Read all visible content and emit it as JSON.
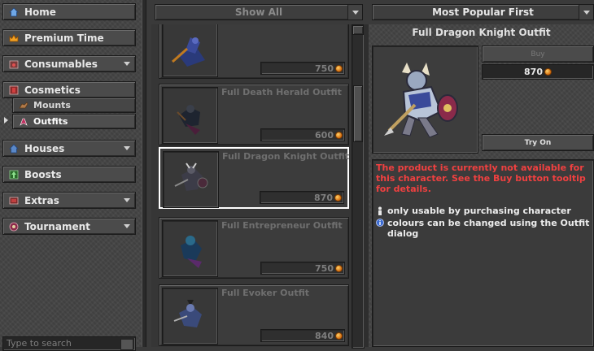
{
  "sidebar": {
    "categories": [
      {
        "label": "Home",
        "icon": "home-icon"
      },
      {
        "label": "Premium Time",
        "icon": "crown-icon"
      },
      {
        "label": "Consumables",
        "icon": "potion-icon"
      },
      {
        "label": "Cosmetics",
        "icon": "cosmetics-icon"
      },
      {
        "label": "Houses",
        "icon": "house-icon"
      },
      {
        "label": "Boosts",
        "icon": "boost-icon"
      },
      {
        "label": "Extras",
        "icon": "extras-icon"
      },
      {
        "label": "Tournament",
        "icon": "tournament-icon"
      }
    ],
    "subitems": [
      {
        "label": "Mounts",
        "icon": "mount-icon"
      },
      {
        "label": "Outfits",
        "icon": "outfit-icon",
        "selected": true
      }
    ],
    "search_placeholder": "Type to search"
  },
  "toolbar": {
    "filter_label": "Show All",
    "sort_label": "Most Popular First"
  },
  "products": [
    {
      "name": "",
      "price": "750"
    },
    {
      "name": "Full Death Herald Outfit",
      "price": "600"
    },
    {
      "name": "Full Dragon Knight Outfit",
      "price": "870",
      "selected": true
    },
    {
      "name": "Full Entrepreneur Outfit",
      "price": "750"
    },
    {
      "name": "Full Evoker Outfit",
      "price": "840"
    }
  ],
  "details": {
    "title": "Full Dragon Knight Outfit",
    "buy_label": "Buy",
    "price": "870",
    "tryon_label": "Try On",
    "warning": "The product is currently not available for this character. See the Buy button tooltip for details.",
    "notes": [
      {
        "icon": "character-icon",
        "text": "only usable by purchasing character"
      },
      {
        "icon": "info-icon",
        "text": "colours can be changed using the Outfit dialog"
      }
    ]
  },
  "colors": {
    "warning": "#f04040",
    "selection": "#ffffff",
    "coin": "#e07a10"
  }
}
